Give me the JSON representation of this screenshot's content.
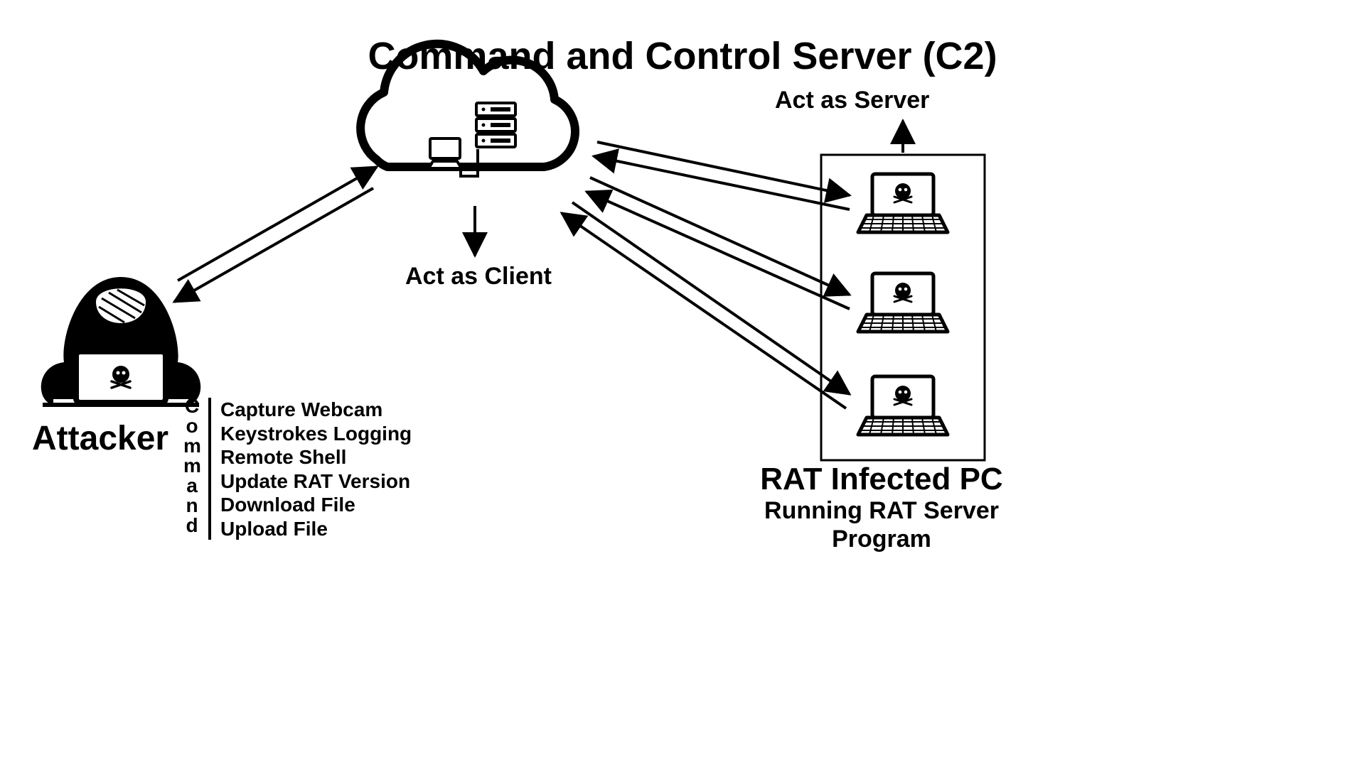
{
  "title": "Command and Control Server (C2)",
  "attacker_label": "Attacker",
  "act_as_client": "Act as Client",
  "act_as_server": "Act as Server",
  "infected_title": "RAT Infected PC",
  "infected_sub1": "Running RAT Server",
  "infected_sub2": "Program",
  "command_vert": [
    "C",
    "o",
    "m",
    "m",
    "a",
    "n",
    "d"
  ],
  "commands": [
    "Capture Webcam",
    "Keystrokes Logging",
    "Remote Shell",
    "Update RAT Version",
    "Download File",
    "Upload File"
  ]
}
